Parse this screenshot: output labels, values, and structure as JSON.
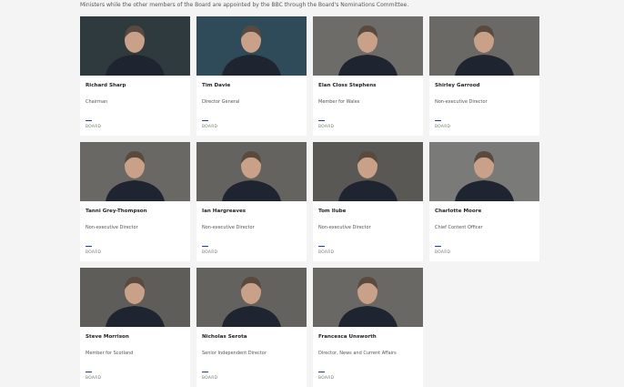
{
  "intro_text": "Ministers while the other members of the Board are appointed by the BBC through the Board's Nominations Committee.",
  "members": [
    {
      "name": "Richard Sharp",
      "role": "Chairman",
      "tag": "BOARD",
      "bg": "#2f3a3f"
    },
    {
      "name": "Tim Davie",
      "role": "Director General",
      "tag": "BOARD",
      "bg": "#2f4a58"
    },
    {
      "name": "Elan Closs Stephens",
      "role": "Member for Wales",
      "tag": "BOARD",
      "bg": "#6e6c69"
    },
    {
      "name": "Shirley Garrood",
      "role": "Non-executive Director",
      "tag": "BOARD",
      "bg": "#6b6966"
    },
    {
      "name": "Tanni Grey-Thompson",
      "role": "Non-executive Director",
      "tag": "BOARD",
      "bg": "#6a6865"
    },
    {
      "name": "Ian Hargreaves",
      "role": "Non-executive Director",
      "tag": "BOARD",
      "bg": "#65635f"
    },
    {
      "name": "Tom Ilube",
      "role": "Non-executive Director",
      "tag": "BOARD",
      "bg": "#595855"
    },
    {
      "name": "Charlotte Moore",
      "role": "Chief Content Officer",
      "tag": "BOARD",
      "bg": "#7a7a79"
    },
    {
      "name": "Steve Morrison",
      "role": "Member for Scotland",
      "tag": "BOARD",
      "bg": "#5e5d5a"
    },
    {
      "name": "Nicholas Serota",
      "role": "Senior Independent Director",
      "tag": "BOARD",
      "bg": "#63625e"
    },
    {
      "name": "Francesca Unsworth",
      "role": "Director, News and Current Affairs",
      "tag": "BOARD",
      "bg": "#6a6864"
    }
  ]
}
